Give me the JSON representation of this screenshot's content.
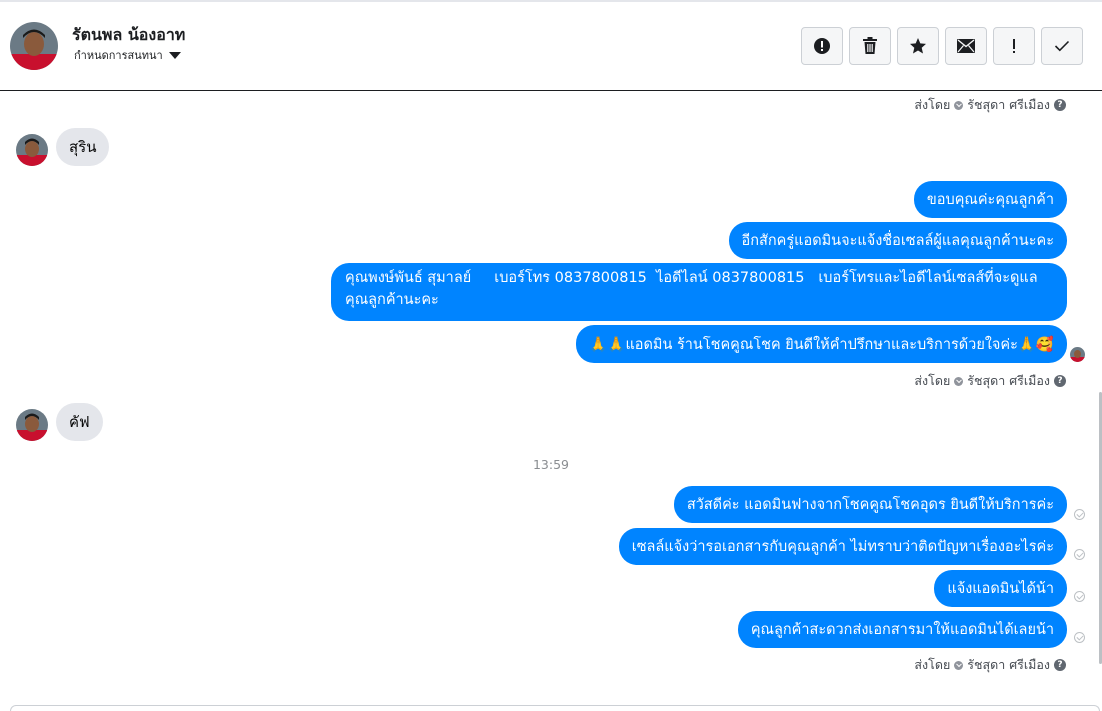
{
  "header": {
    "contact_name": "รัตนพล น้องอาท",
    "assign_label": "กำหนดการสนทนา",
    "actions": [
      {
        "icon": "alert-circle-icon",
        "name": "mark-spam-button"
      },
      {
        "icon": "trash-icon",
        "name": "delete-button"
      },
      {
        "icon": "star-icon",
        "name": "star-button"
      },
      {
        "icon": "envelope-icon",
        "name": "mark-unread-button"
      },
      {
        "icon": "exclamation-icon",
        "name": "follow-up-button"
      },
      {
        "icon": "checkmark-icon",
        "name": "mark-done-button"
      }
    ]
  },
  "chat": {
    "sent_by_prefix": "ส่งโดย",
    "sender": "รัชสุดา ศรีเมือง",
    "help_mark": "?",
    "timestamp": "13:59",
    "messages": [
      {
        "side": "in",
        "text": "สุริน"
      },
      {
        "side": "out",
        "text": "ขอบคุณค่ะคุณลูกค้า"
      },
      {
        "side": "out",
        "text": "อีกสักครู่แอดมินจะแจ้งชื่อเซลล์ผู้แลคุณลูกค้านะคะ"
      },
      {
        "side": "out",
        "line1": "คุณพงษ์พันธ์ สุมาลย์     เบอร์โทร 0837800815  ไอดีไลน์ 0837800815   เบอร์โทรและไอดีไลน์เซลส์ที่จะดูแล",
        "line2": "คุณลูกค้านะคะ"
      },
      {
        "side": "out",
        "text": "🙏🙏แอดมิน ร้านโชคคูณโชค ยินดีให้คำปรึกษาและบริการด้วยใจค่ะ🙏🥰"
      },
      {
        "side": "in",
        "text": "คัฟ"
      },
      {
        "side": "out",
        "text": "สวัสดีค่ะ แอดมินฟางจากโชคคูณโชคอุดร ยินดีให้บริการค่ะ"
      },
      {
        "side": "out",
        "text": "เซลล์แจ้งว่ารอเอกสารกับคุณลูกค้า  ไม่ทราบว่าติดปัญหาเรื่องอะไรค่ะ"
      },
      {
        "side": "out",
        "text": "แจ้งแอดมินได้น้า"
      },
      {
        "side": "out",
        "text": "คุณลูกค้าสะดวกส่งเอกสารมาให้แอดมินได้เลยน้า"
      }
    ]
  },
  "colors": {
    "outgoing_bubble": "#0084ff",
    "incoming_bubble": "#e4e6eb",
    "avatar_shirt": "#c8102e"
  }
}
